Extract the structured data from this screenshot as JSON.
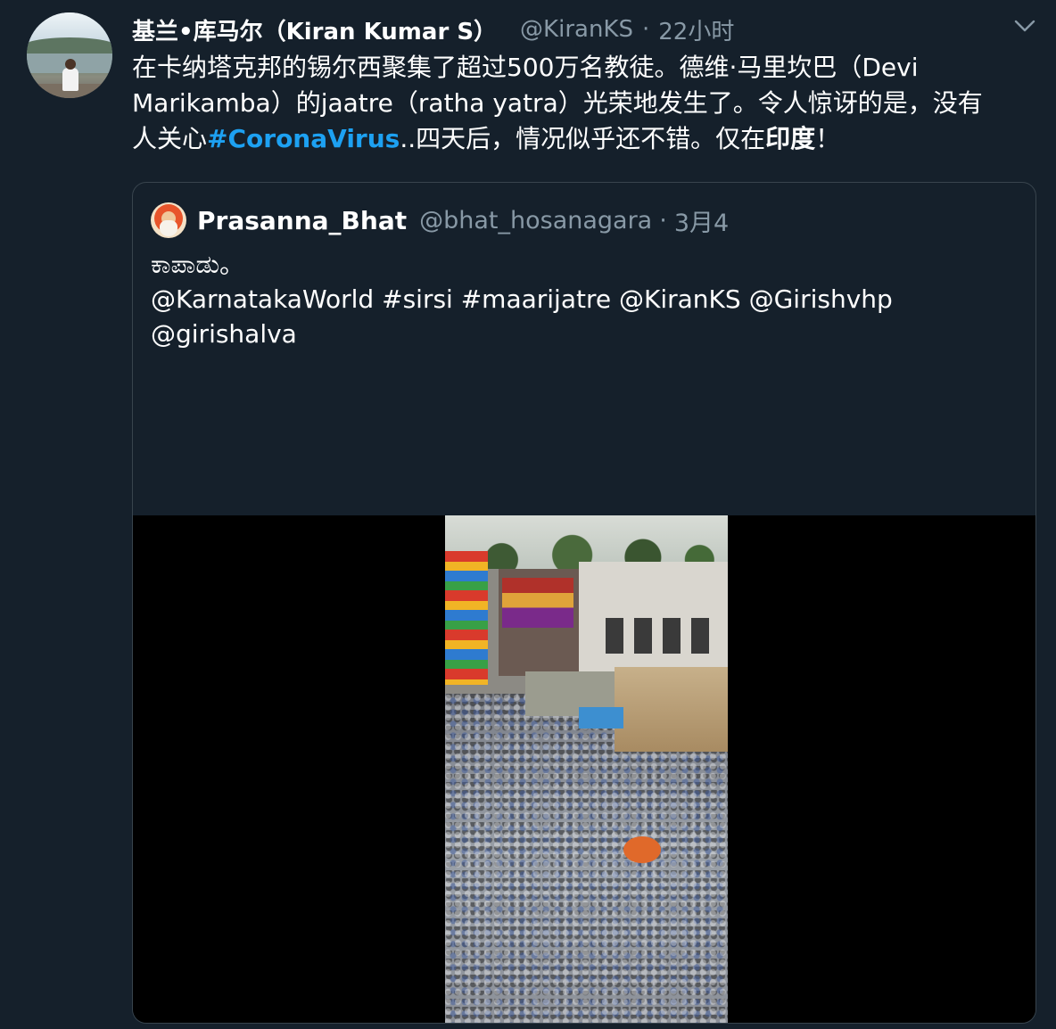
{
  "tweet": {
    "display_name": "基兰•库马尔（Kiran Kumar S）",
    "handle": "@KiranKS",
    "separator": "·",
    "time": "22小时",
    "text_lines": {
      "line1": "在卡纳塔克邦的锡尔西聚集了超过500万名教徒。德维·马里坎巴（Devi",
      "line2": "Marikamba）的jaatre（ratha yatra）光荣地发生了。令人惊讶的是，没有",
      "line3_pre": "人关心",
      "line3_hashtag": "#CoronaVirus",
      "line3_mid": "..四天后，情况似乎还不错。仅在",
      "line3_bold": "印度",
      "line3_end": "！"
    }
  },
  "quoted_tweet": {
    "display_name": "Prasanna_Bhat",
    "handle": "@bhat_hosanagara",
    "separator": "·",
    "date": "3月4",
    "text_line1": "ಕಾಪಾಡು。",
    "text_line2": "@KarnatakaWorld #sirsi #maarijatre @KiranKS @Girishvhp",
    "text_line3": "@girishalva"
  },
  "icons": {
    "menu": "chevron-down-icon",
    "avatar": "user-avatar",
    "quoted_avatar": "quoted-user-avatar"
  },
  "colors": {
    "background": "#15202b",
    "secondary_text": "#8899a6",
    "accent": "#1da1f2",
    "border": "#38444d"
  }
}
